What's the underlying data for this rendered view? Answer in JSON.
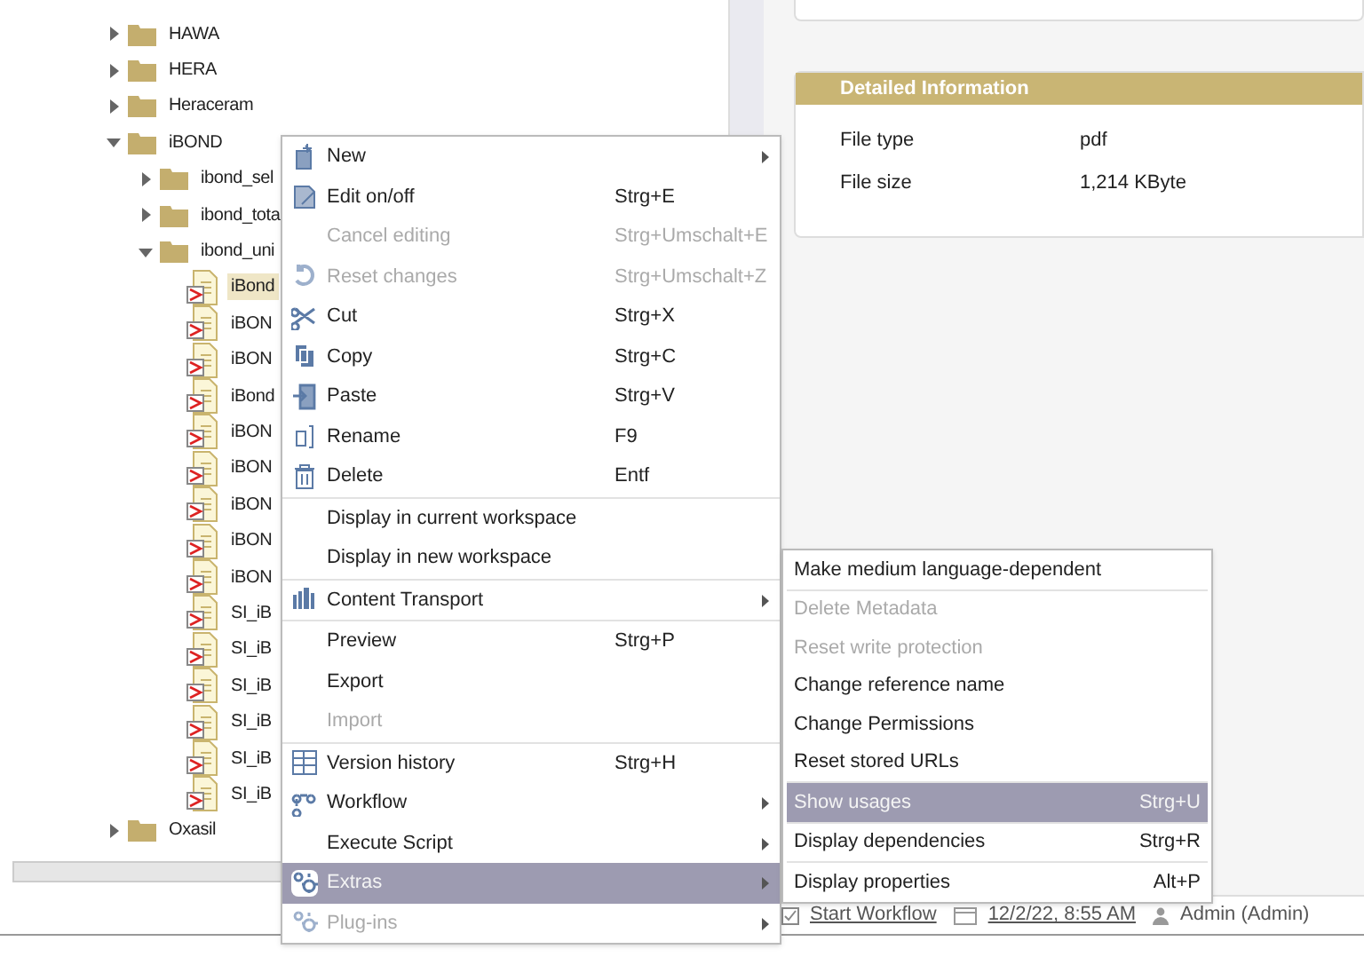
{
  "tree": [
    {
      "kind": "folder",
      "label": "HAWA",
      "expanded": false,
      "selected": false
    },
    {
      "kind": "folder",
      "label": "HERA",
      "expanded": false,
      "selected": false
    },
    {
      "kind": "folder",
      "label": "Heraceram",
      "expanded": false,
      "selected": false
    },
    {
      "kind": "folder",
      "label": "iBOND",
      "expanded": true,
      "selected": false,
      "children": [
        {
          "kind": "folder",
          "label": "ibond_sel",
          "expanded": false,
          "selected": false
        },
        {
          "kind": "folder",
          "label": "ibond_tota",
          "expanded": false,
          "selected": false
        },
        {
          "kind": "folder",
          "label": "ibond_uni",
          "expanded": true,
          "selected": false,
          "children": [
            {
              "kind": "file",
              "label": "iBond",
              "selected": true
            },
            {
              "kind": "file",
              "label": "iBON",
              "selected": false
            },
            {
              "kind": "file",
              "label": "iBON",
              "selected": false
            },
            {
              "kind": "file",
              "label": "iBond",
              "selected": false
            },
            {
              "kind": "file",
              "label": "iBON",
              "selected": false
            },
            {
              "kind": "file",
              "label": "iBON",
              "selected": false
            },
            {
              "kind": "file",
              "label": "iBON",
              "selected": false
            },
            {
              "kind": "file",
              "label": "iBON",
              "selected": false
            },
            {
              "kind": "file",
              "label": "iBON",
              "selected": false
            },
            {
              "kind": "file",
              "label": "SI_iB",
              "selected": false
            },
            {
              "kind": "file",
              "label": "SI_iB",
              "selected": false
            },
            {
              "kind": "file",
              "label": "SI_iB",
              "selected": false
            },
            {
              "kind": "file",
              "label": "SI_iB",
              "selected": false
            },
            {
              "kind": "file",
              "label": "SI_iB",
              "selected": false
            },
            {
              "kind": "file",
              "label": "SI_iB",
              "selected": false
            }
          ]
        }
      ]
    },
    {
      "kind": "folder",
      "label": "Oxasil",
      "expanded": false,
      "selected": false
    }
  ],
  "details": {
    "title": "Detailed Information",
    "rows": [
      {
        "label": "File type",
        "value": "pdf"
      },
      {
        "label": "File size",
        "value": "1,214 KByte"
      }
    ]
  },
  "context_menu": {
    "groups": [
      [
        {
          "label": "New",
          "submenu": true,
          "disabled": false,
          "selected": false
        },
        {
          "label": "Edit on/off",
          "shortcut": "Strg+E",
          "submenu": false,
          "disabled": false,
          "selected": false
        },
        {
          "label": "Cancel editing",
          "shortcut": "Strg+Umschalt+E",
          "submenu": false,
          "disabled": true,
          "selected": false
        },
        {
          "label": "Reset changes",
          "shortcut": "Strg+Umschalt+Z",
          "submenu": false,
          "disabled": true,
          "selected": false
        },
        {
          "label": "Cut",
          "shortcut": "Strg+X",
          "submenu": false,
          "disabled": false,
          "selected": false
        },
        {
          "label": "Copy",
          "shortcut": "Strg+C",
          "submenu": false,
          "disabled": false,
          "selected": false
        },
        {
          "label": "Paste",
          "shortcut": "Strg+V",
          "submenu": false,
          "disabled": false,
          "selected": false
        },
        {
          "label": "Rename",
          "shortcut": "F9",
          "submenu": false,
          "disabled": false,
          "selected": false
        },
        {
          "label": "Delete",
          "shortcut": "Entf",
          "submenu": false,
          "disabled": false,
          "selected": false
        }
      ],
      [
        {
          "label": "Display in current workspace",
          "submenu": false,
          "disabled": false,
          "selected": false
        },
        {
          "label": "Display in new workspace",
          "submenu": false,
          "disabled": false,
          "selected": false
        }
      ],
      [
        {
          "label": "Content Transport",
          "submenu": true,
          "disabled": false,
          "selected": false
        }
      ],
      [
        {
          "label": "Preview",
          "shortcut": "Strg+P",
          "submenu": false,
          "disabled": false,
          "selected": false
        },
        {
          "label": "Export",
          "submenu": false,
          "disabled": false,
          "selected": false
        },
        {
          "label": "Import",
          "submenu": false,
          "disabled": true,
          "selected": false
        }
      ],
      [
        {
          "label": "Version history",
          "shortcut": "Strg+H",
          "submenu": false,
          "disabled": false,
          "selected": false
        },
        {
          "label": "Workflow",
          "submenu": true,
          "disabled": false,
          "selected": false
        },
        {
          "label": "Execute Script",
          "submenu": true,
          "disabled": false,
          "selected": false
        },
        {
          "label": "Extras",
          "submenu": true,
          "disabled": false,
          "selected": true
        },
        {
          "label": "Plug-ins",
          "submenu": true,
          "disabled": true,
          "selected": false
        }
      ]
    ]
  },
  "submenu": {
    "groups": [
      [
        {
          "label": "Make medium language-dependent",
          "disabled": false,
          "selected": false
        }
      ],
      [
        {
          "label": "Delete Metadata",
          "disabled": true,
          "selected": false
        },
        {
          "label": "Reset write protection",
          "disabled": true,
          "selected": false
        },
        {
          "label": "Change reference name",
          "disabled": false,
          "selected": false
        },
        {
          "label": "Change Permissions",
          "disabled": false,
          "selected": false
        },
        {
          "label": "Reset stored URLs",
          "disabled": false,
          "selected": false
        }
      ],
      [
        {
          "label": "Show usages",
          "shortcut": "Strg+U",
          "disabled": false,
          "selected": true
        }
      ],
      [
        {
          "label": "Display dependencies",
          "shortcut": "Strg+R",
          "disabled": false,
          "selected": false
        }
      ],
      [
        {
          "label": "Display properties",
          "shortcut": "Alt+P",
          "disabled": false,
          "selected": false
        }
      ]
    ]
  },
  "status_bar": {
    "workflow_link": "Start Workflow",
    "date_link": "12/2/22, 8:55 AM",
    "user": "Admin (Admin)"
  }
}
